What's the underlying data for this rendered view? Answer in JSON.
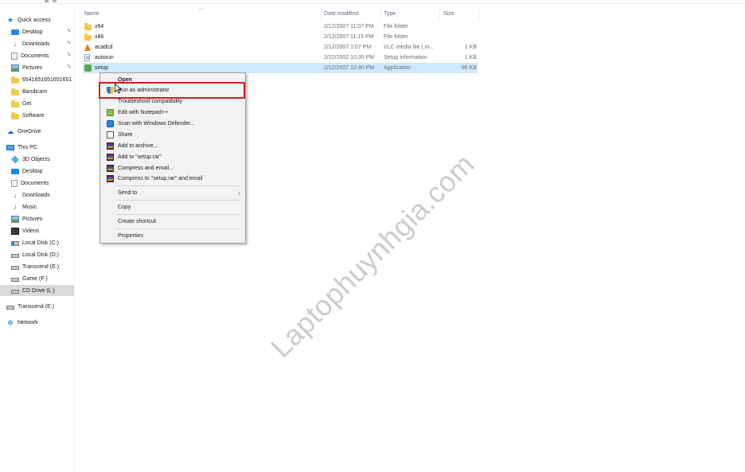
{
  "file_list": {
    "columns": [
      "Name",
      "Date modified",
      "Type",
      "Size"
    ],
    "rows": [
      {
        "name": "x64",
        "date": "2/12/2007 11:07 PM",
        "type": "File folder",
        "size": "",
        "icon": "folder-icon"
      },
      {
        "name": "x86",
        "date": "2/12/2007 11:15 PM",
        "type": "File folder",
        "size": "",
        "icon": "folder-icon"
      },
      {
        "name": "acadcd",
        "date": "2/12/2007 1:07 PM",
        "type": "VLC media file (.m...",
        "size": "1 KB",
        "icon": "vlc-icon"
      },
      {
        "name": "autorun",
        "date": "2/22/2002 10:35 PM",
        "type": "Setup information",
        "size": "1 KB",
        "icon": "setup-info-icon"
      },
      {
        "name": "setup",
        "date": "2/12/2007 12:40 PM",
        "type": "Application",
        "size": "86 KB",
        "icon": "application-icon"
      }
    ]
  },
  "nav": {
    "items": [
      {
        "label": "Quick access",
        "icon": "star-icon"
      },
      {
        "label": "Desktop",
        "icon": "desktop-icon",
        "pinned": true
      },
      {
        "label": "Downloads",
        "icon": "download-icon",
        "pinned": true
      },
      {
        "label": "Documents",
        "icon": "documents-icon",
        "pinned": true
      },
      {
        "label": "Pictures",
        "icon": "pictures-icon",
        "pinned": true
      },
      {
        "label": "6541651651651651",
        "icon": "folder-icon"
      },
      {
        "label": "Bandicam",
        "icon": "folder-icon"
      },
      {
        "label": "Get",
        "icon": "folder-icon"
      },
      {
        "label": "Software",
        "icon": "folder-icon"
      },
      {
        "label": "OneDrive",
        "icon": "cloud-icon"
      },
      {
        "label": "This PC",
        "icon": "computer-icon"
      },
      {
        "label": "3D Objects",
        "icon": "3d-objects-icon"
      },
      {
        "label": "Desktop",
        "icon": "desktop-icon"
      },
      {
        "label": "Documents",
        "icon": "documents-icon"
      },
      {
        "label": "Downloads",
        "icon": "download-icon"
      },
      {
        "label": "Music",
        "icon": "music-icon"
      },
      {
        "label": "Pictures",
        "icon": "pictures-icon"
      },
      {
        "label": "Videos",
        "icon": "videos-icon"
      },
      {
        "label": "Local Disk (C:)",
        "icon": "windows-drive-icon"
      },
      {
        "label": "Local Disk (D:)",
        "icon": "drive-icon"
      },
      {
        "label": "Transcend (E:)",
        "icon": "drive-icon"
      },
      {
        "label": "Game (F:)",
        "icon": "drive-icon"
      },
      {
        "label": "CD Drive (L:)",
        "icon": "cd-drive-icon",
        "selected": true
      },
      {
        "label": "Transcend (E:)",
        "icon": "drive-icon"
      },
      {
        "label": "Network",
        "icon": "network-icon"
      }
    ]
  },
  "context_menu": {
    "items": [
      {
        "label": "Open"
      },
      {
        "label": "Run as administrator",
        "icon": "uac-shield-icon"
      },
      {
        "label": "Troubleshoot compatibility"
      },
      {
        "label": "Edit with Notepad++",
        "icon": "notepad-plus-plus-icon"
      },
      {
        "label": "Scan with Windows Defender...",
        "icon": "windows-defender-icon"
      },
      {
        "label": "Share",
        "icon": "share-icon"
      },
      {
        "label": "Add to archive...",
        "icon": "winrar-icon"
      },
      {
        "label": "Add to \"setup.rar\"",
        "icon": "winrar-icon"
      },
      {
        "label": "Compress and email...",
        "icon": "winrar-icon"
      },
      {
        "label": "Compress to \"setup.rar\" and email",
        "icon": "winrar-icon"
      },
      {
        "label": "Send to",
        "submenu": true
      },
      {
        "label": "Copy"
      },
      {
        "label": "Create shortcut"
      },
      {
        "label": "Properties"
      }
    ],
    "highlighted": "Run as administrator",
    "highlight_color": "#d21f1f"
  },
  "watermark": "Laptophuynhgia.com",
  "colors": {
    "selected_row": "#cde8ff",
    "nav_selected": "#d9d9d9",
    "highlight_box": "#d21f1f"
  }
}
